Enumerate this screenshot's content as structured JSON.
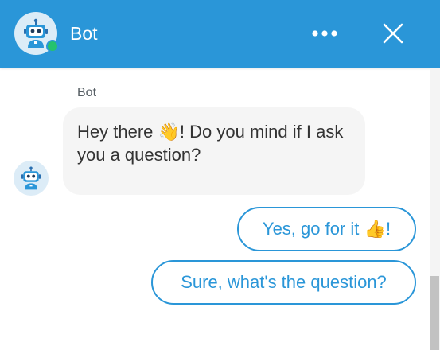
{
  "header": {
    "title": "Bot",
    "status": "online",
    "icons": [
      "robot-avatar-icon",
      "more-dots-icon",
      "close-icon"
    ]
  },
  "messages": [
    {
      "sender": "Bot",
      "text_before": "Hey there ",
      "emoji": "👋",
      "text_after": "! Do you mind if I ask you a question?"
    }
  ],
  "quick_replies": [
    {
      "text": "Yes, go for it ",
      "emoji": "👍",
      "suffix": "!"
    },
    {
      "text": "Sure, what's the question?"
    }
  ],
  "colors": {
    "accent": "#2a96d8",
    "online": "#25c26e",
    "bubble": "#f5f5f5"
  }
}
